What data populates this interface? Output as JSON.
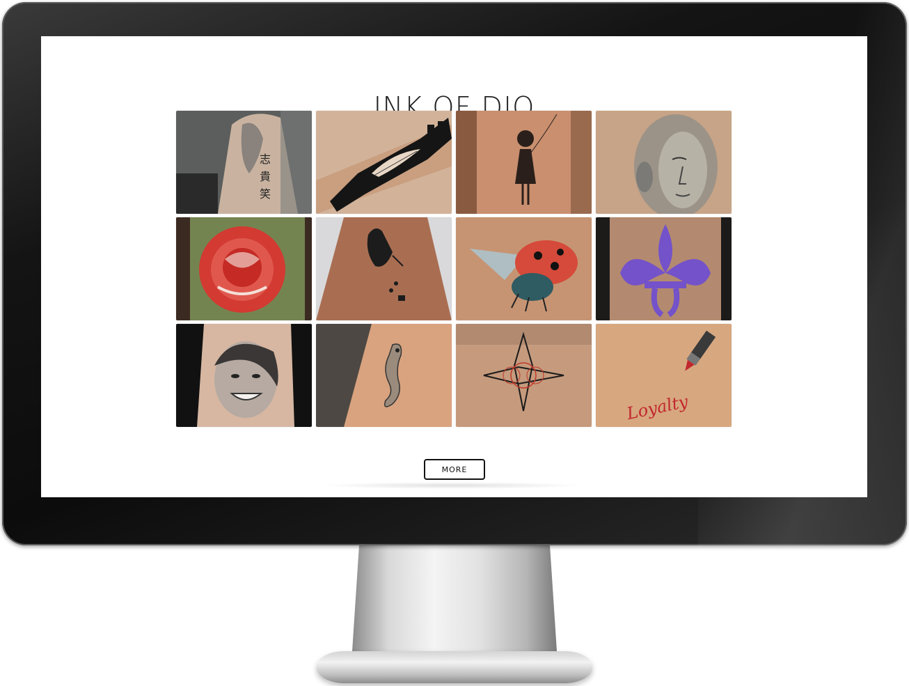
{
  "site": {
    "logo_text": "INK OF DJO"
  },
  "gallery": {
    "tiles": [
      {
        "icon": "kanji-arm-tattoo"
      },
      {
        "icon": "tribal-feather-tattoo"
      },
      {
        "icon": "girl-balloon-tattoo"
      },
      {
        "icon": "statue-face-tattoo"
      },
      {
        "icon": "red-rose-tattoo"
      },
      {
        "icon": "bird-silhouette-tattoo"
      },
      {
        "icon": "ladybug-tattoo"
      },
      {
        "icon": "fleur-de-lis-tattoo"
      },
      {
        "icon": "portrait-tattoo"
      },
      {
        "icon": "seahorse-tattoo"
      },
      {
        "icon": "geometric-star-tattoo"
      },
      {
        "icon": "lipstick-loyalty-tattoo",
        "script_text": "Loyalty"
      }
    ]
  },
  "actions": {
    "more_label": "MORE"
  },
  "colors": {
    "bezel": "#111111",
    "screen": "#ffffff",
    "button_border": "#111111"
  }
}
